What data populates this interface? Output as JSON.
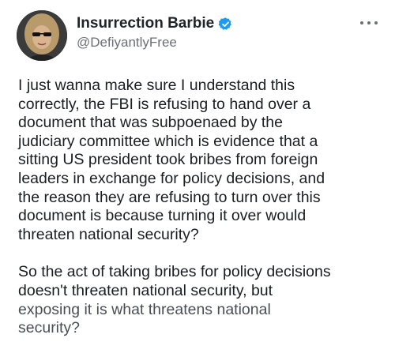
{
  "tweet": {
    "author": {
      "display_name": "Insurrection Barbie",
      "handle": "@DefiyantlyFree",
      "verified": true
    },
    "more_icon": "more-horizontal-icon",
    "paragraphs": [
      {
        "lines": [
          "I just wanna make sure I understand this",
          "correctly, the FBI is refusing to hand over a",
          "document that was subpoenaed by the",
          "judiciary committee which is evidence that a",
          "sitting US president took bribes from foreign",
          "leaders in exchange for policy decisions, and",
          "the reason they are refusing to turn over this",
          "document is because turning it over would",
          "threaten national security?"
        ]
      },
      {
        "lines": [
          "So the act of taking bribes for policy decisions",
          "doesn't threaten national security, but",
          "exposing it is what threatens national",
          "security?"
        ]
      }
    ]
  },
  "colors": {
    "verified_badge": "#1d9bf0",
    "text": "#1a1d21",
    "secondary": "#6b7076"
  }
}
